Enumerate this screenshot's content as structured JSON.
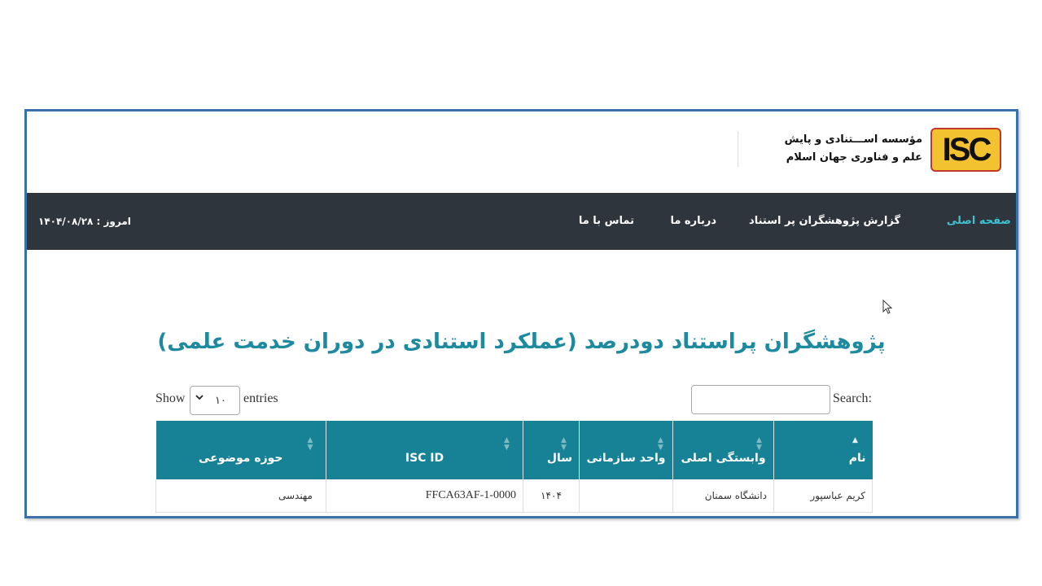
{
  "header": {
    "logo_text": "ISC",
    "org_name_line1": "مؤسسه اســـتنادی و پایش",
    "org_name_line2": "علم و فناوری جهان اسلام"
  },
  "nav": {
    "items": [
      {
        "label": "صفحه اصلی",
        "active": true
      },
      {
        "label": "گزارش پژوهشگران پر استناد",
        "active": false
      },
      {
        "label": "درباره ما",
        "active": false
      },
      {
        "label": "تماس با ما",
        "active": false
      }
    ],
    "date_text": "امروز : ۱۴۰۴/۰۸/۲۸"
  },
  "page": {
    "title": "پژوهشگران پراستناد دودرصد (عملکرد استنادی در دوران خدمت علمی)"
  },
  "table_controls": {
    "show_label": "Show",
    "entries_label": "entries",
    "page_length": "۱۰",
    "search_label": "Search:",
    "search_value": ""
  },
  "table": {
    "columns": [
      "نام",
      "وابستگی اصلی",
      "واحد سازمانی",
      "سال",
      "ISC ID",
      "حوزه موضوعی"
    ],
    "rows": [
      [
        "کریم عباسپور",
        "دانشگاه سمنان",
        "",
        "۱۴۰۴",
        "FFCA63AF-1-0000",
        "مهندسی"
      ]
    ]
  },
  "colors": {
    "navbar_bg": "#2f353c",
    "accent": "#3fc1d3",
    "title": "#1e8aa0",
    "table_header_bg": "#178196",
    "frame_border": "#3a71a8"
  }
}
